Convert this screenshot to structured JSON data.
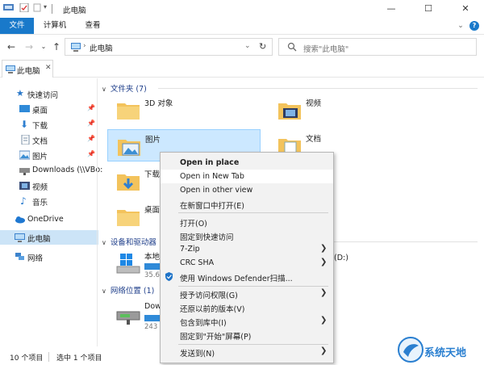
{
  "window": {
    "title": "此电脑",
    "minimize": "—",
    "maximize": "☐",
    "close": "✕"
  },
  "ribbon": {
    "tabs": [
      "文件",
      "计算机",
      "查看"
    ],
    "help": "?"
  },
  "address": {
    "path": "此电脑",
    "search_placeholder": "搜索\"此电脑\""
  },
  "doc_tab": {
    "label": "此电脑",
    "close": "✕"
  },
  "sidebar": {
    "items": [
      {
        "label": "快速访问",
        "icon": "star-icon"
      },
      {
        "label": "桌面",
        "icon": "desktop-icon",
        "pinned": true
      },
      {
        "label": "下载",
        "icon": "download-icon",
        "pinned": true
      },
      {
        "label": "文档",
        "icon": "document-icon",
        "pinned": true
      },
      {
        "label": "图片",
        "icon": "picture-icon",
        "pinned": true
      },
      {
        "label": "Downloads (\\\\VBo:",
        "icon": "network-drive-icon"
      },
      {
        "label": "视频",
        "icon": "video-icon"
      },
      {
        "label": "音乐",
        "icon": "music-icon"
      },
      {
        "label": "OneDrive",
        "icon": "cloud-icon"
      },
      {
        "label": "此电脑",
        "icon": "computer-icon"
      },
      {
        "label": "网络",
        "icon": "network-icon"
      }
    ],
    "pin_glyph": "📌"
  },
  "main": {
    "folders_header": "文件夹 (7)",
    "folders": [
      {
        "label": "3D 对象"
      },
      {
        "label": "视频"
      },
      {
        "label": "图片"
      },
      {
        "label": "文档"
      },
      {
        "label": "下载"
      },
      {
        "label": "桌面"
      }
    ],
    "devices_header": "设备和驱动器",
    "devices": [
      {
        "label": "本地",
        "sub": "35.6"
      },
      {
        "label": "(D:)",
        "sub": ""
      }
    ],
    "network_header": "网络位置 (1)",
    "network": [
      {
        "label": "Dow",
        "sub": "243 ("
      }
    ]
  },
  "status": {
    "count": "10 个项目",
    "selected": "选中 1 个项目"
  },
  "context_menu": {
    "items": [
      {
        "label": "Open in place",
        "bold": true
      },
      {
        "label": "Open in New Tab",
        "hover": true
      },
      {
        "label": "Open in other view"
      },
      {
        "label": "在新窗口中打开(E)"
      },
      {
        "label": "打开(O)"
      },
      {
        "label": "固定到快速访问"
      },
      {
        "label": "7-Zip",
        "submenu": true
      },
      {
        "label": "CRC SHA",
        "submenu": true
      },
      {
        "label": "使用 Windows Defender扫描...",
        "icon": "defender-shield-icon"
      },
      {
        "label": "授予访问权限(G)",
        "submenu": true
      },
      {
        "label": "还原以前的版本(V)"
      },
      {
        "label": "包含到库中(I)",
        "submenu": true
      },
      {
        "label": "固定到\"开始\"屏幕(P)"
      },
      {
        "label": "发送到(N)",
        "submenu": true
      }
    ],
    "arrow": "❯"
  },
  "watermark": {
    "text": "系统天地"
  },
  "colors": {
    "accent": "#1979ca",
    "selection": "#cce8ff",
    "folder": "#f3c35c",
    "header_blue": "#1e3e8a"
  }
}
